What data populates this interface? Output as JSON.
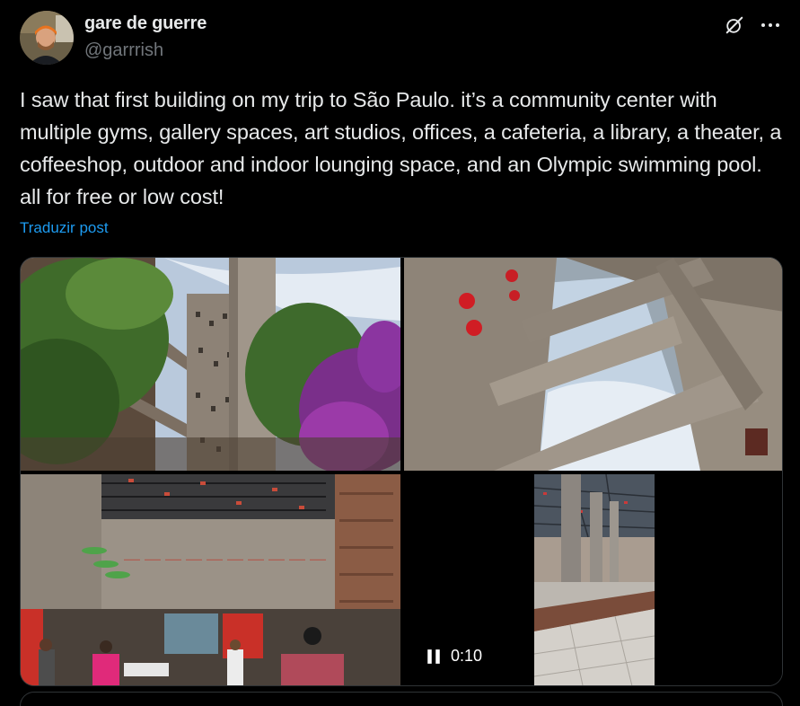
{
  "author": {
    "display_name": "gare de guerre",
    "handle": "@garrrish"
  },
  "post": {
    "text": "I saw that first building on my trip to São Paulo. it’s a community center with multiple gyms, gallery spaces, art studios, offices, a cafeteria, a library, a theater, a coffeeshop, outdoor and indoor lounging space, and an Olympic swimming pool. all for free or low cost!",
    "translate_label": "Traduzir post"
  },
  "media": {
    "video_time": "0:10"
  },
  "icons": {
    "grok": "grok-icon",
    "more": "more-icon",
    "pause": "pause-icon"
  },
  "colors": {
    "background": "#000000",
    "text": "#e7e9ea",
    "muted": "#71767b",
    "link": "#1d9bf0",
    "border": "#2f3336"
  }
}
